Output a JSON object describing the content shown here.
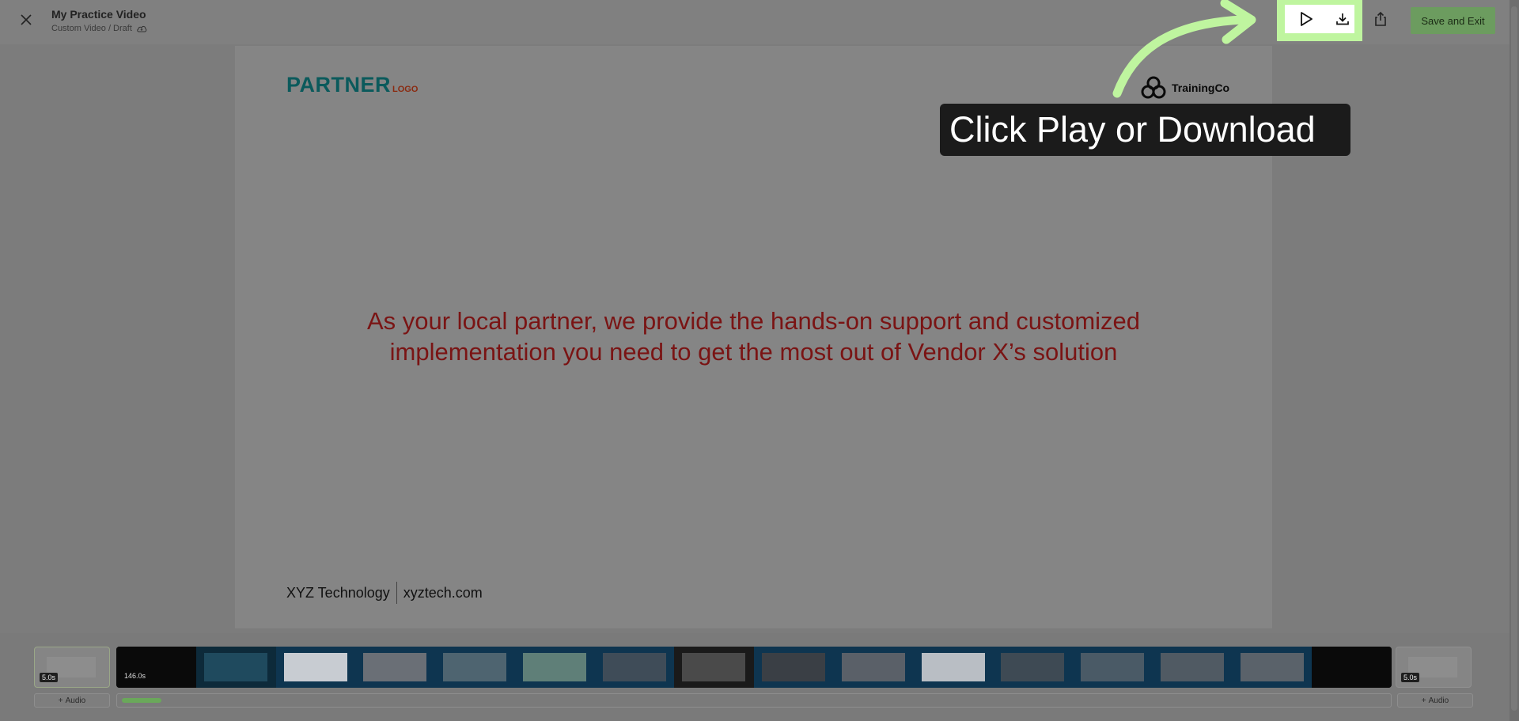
{
  "header": {
    "title": "My Practice Video",
    "subtitle": "Custom Video / Draft",
    "save_exit_label": "Save and Exit"
  },
  "icons": {
    "close": "close-icon",
    "cloud": "cloud-sync-icon",
    "play": "play-icon",
    "download": "download-icon",
    "share": "share-icon"
  },
  "colors": {
    "highlight": "#bff59f",
    "save_button": "#6c9c5f",
    "slide_text": "#7a1414",
    "partner_logo": "#0b5a5c"
  },
  "slide": {
    "partner_logo": "PARTNER",
    "partner_logo_small": "LOGO",
    "trainingco_label": "TrainingCo",
    "body_line1": "As your local partner, we provide the hands-on support and customized",
    "body_line2": "implementation you need to get the most out of Vendor X’s solution",
    "footer_company": "XYZ Technology",
    "footer_url": "xyztech.com"
  },
  "callout": {
    "text": "Click Play or Download"
  },
  "timeline": {
    "left_duration": "5.0s",
    "strip_duration": "146.0s",
    "right_duration": "5.0s",
    "audio_label": "Audio"
  }
}
